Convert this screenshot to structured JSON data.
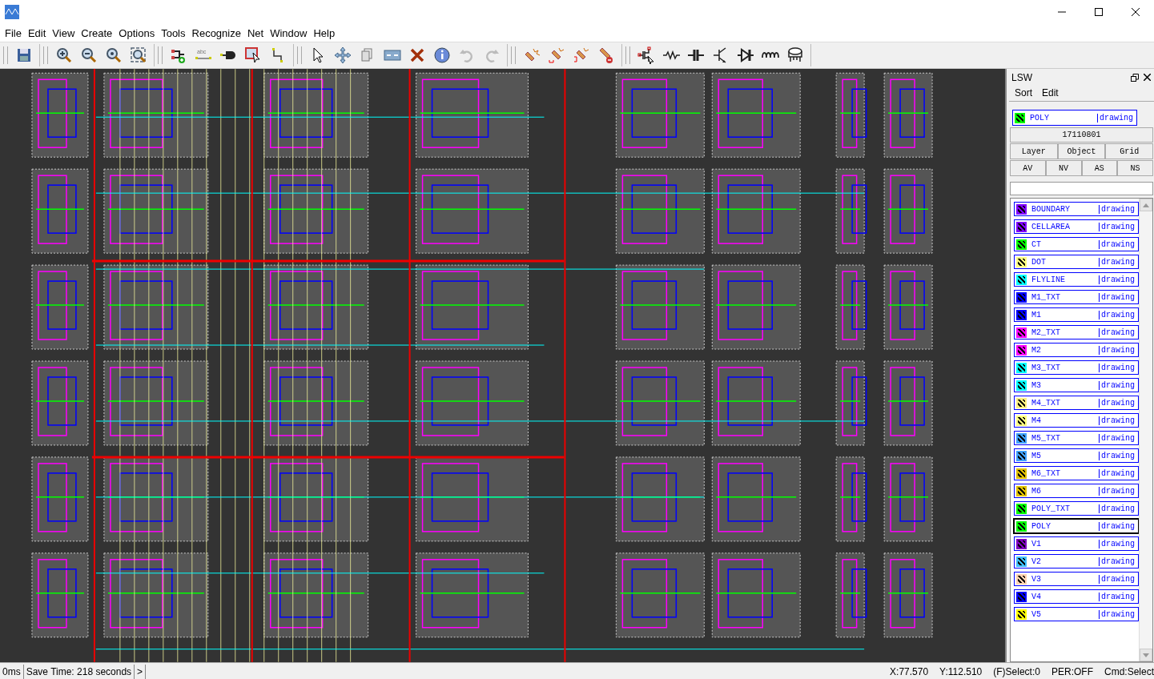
{
  "toolbar": {
    "label_tool_text": "abc"
  },
  "menu": [
    "File",
    "Edit",
    "View",
    "Create",
    "Options",
    "Tools",
    "Recognize",
    "Net",
    "Window",
    "Help"
  ],
  "lsw": {
    "title": "LSW",
    "menu": [
      "Sort",
      "Edit"
    ],
    "current": {
      "name": "POLY",
      "purpose": "drawing",
      "color": "#00ff00"
    },
    "cell": "17110801",
    "buttons_row1": [
      "Layer",
      "Object",
      "Grid"
    ],
    "buttons_row2": [
      "AV",
      "NV",
      "AS",
      "NS"
    ],
    "layers": [
      {
        "name": "BOUNDARY",
        "purpose": "drawing",
        "color": "#8000ff",
        "selected": false
      },
      {
        "name": "CELLAREA",
        "purpose": "drawing",
        "color": "#8000ff",
        "selected": false
      },
      {
        "name": "CT",
        "purpose": "drawing",
        "color": "#00ff00",
        "selected": false
      },
      {
        "name": "DOT",
        "purpose": "drawing",
        "color": "#ffff80",
        "selected": false
      },
      {
        "name": "FLYLINE",
        "purpose": "drawing",
        "color": "#00ffff",
        "selected": false
      },
      {
        "name": "M1_TXT",
        "purpose": "drawing",
        "color": "#0000ff",
        "selected": false
      },
      {
        "name": "M1",
        "purpose": "drawing",
        "color": "#0000ff",
        "selected": false
      },
      {
        "name": "M2_TXT",
        "purpose": "drawing",
        "color": "#ff00ff",
        "selected": false
      },
      {
        "name": "M2",
        "purpose": "drawing",
        "color": "#ff00ff",
        "selected": false
      },
      {
        "name": "M3_TXT",
        "purpose": "drawing",
        "color": "#00ffff",
        "selected": false
      },
      {
        "name": "M3",
        "purpose": "drawing",
        "color": "#00ffff",
        "selected": false
      },
      {
        "name": "M4_TXT",
        "purpose": "drawing",
        "color": "#fff080",
        "selected": false
      },
      {
        "name": "M4",
        "purpose": "drawing",
        "color": "#ffff81",
        "selected": false
      },
      {
        "name": "M5_TXT",
        "purpose": "drawing",
        "color": "#40a0ff",
        "selected": false
      },
      {
        "name": "M5",
        "purpose": "drawing",
        "color": "#40a0fe",
        "selected": false
      },
      {
        "name": "M6_TXT",
        "purpose": "drawing",
        "color": "#e0c000",
        "selected": false
      },
      {
        "name": "M6",
        "purpose": "drawing",
        "color": "#e0c001",
        "selected": false
      },
      {
        "name": "POLY_TXT",
        "purpose": "drawing",
        "color": "#00ff01",
        "selected": false
      },
      {
        "name": "POLY",
        "purpose": "drawing",
        "color": "#00ff02",
        "selected": true
      },
      {
        "name": "V1",
        "purpose": "drawing",
        "color": "#8000c0",
        "selected": false
      },
      {
        "name": "V2",
        "purpose": "drawing",
        "color": "#40c0ff",
        "selected": false
      },
      {
        "name": "V3",
        "purpose": "drawing",
        "color": "#ffd0b0",
        "selected": false
      },
      {
        "name": "V4",
        "purpose": "drawing",
        "color": "#0000fe",
        "selected": false
      },
      {
        "name": "V5",
        "purpose": "drawing",
        "color": "#ffff00",
        "selected": false
      }
    ]
  },
  "status_bar": {
    "left": [
      "0ms",
      "Save Time: 218 seconds",
      ">"
    ],
    "right": [
      "X:77.570",
      "Y:112.510",
      "(F)Select:0",
      "PER:OFF",
      "Cmd:Select"
    ]
  }
}
